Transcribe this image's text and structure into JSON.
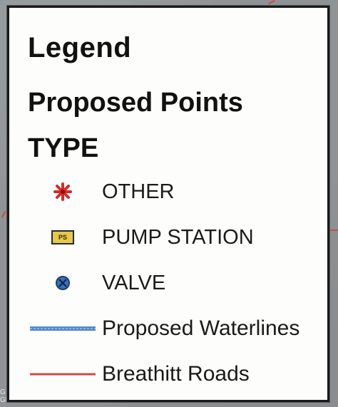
{
  "legend": {
    "title": "Legend",
    "layer_name": "Proposed Points",
    "field_name": "TYPE",
    "point_items": [
      {
        "label": "OTHER",
        "symbol": "red-asterisk-icon",
        "color": "#d42a2a"
      },
      {
        "label": "PUMP STATION",
        "symbol": "pump-station-icon",
        "symbol_text": "PS",
        "color": "#e6c84a"
      },
      {
        "label": "VALVE",
        "symbol": "valve-icon",
        "color": "#3a6fb5"
      }
    ],
    "line_items": [
      {
        "label": "Proposed Waterlines",
        "symbol": "blue-line-icon",
        "color": "#4f88c9"
      },
      {
        "label": "Breathitt Roads",
        "symbol": "red-line-icon",
        "color": "#d04a4a"
      }
    ]
  },
  "map": {
    "edge_text": "G\nGN"
  }
}
